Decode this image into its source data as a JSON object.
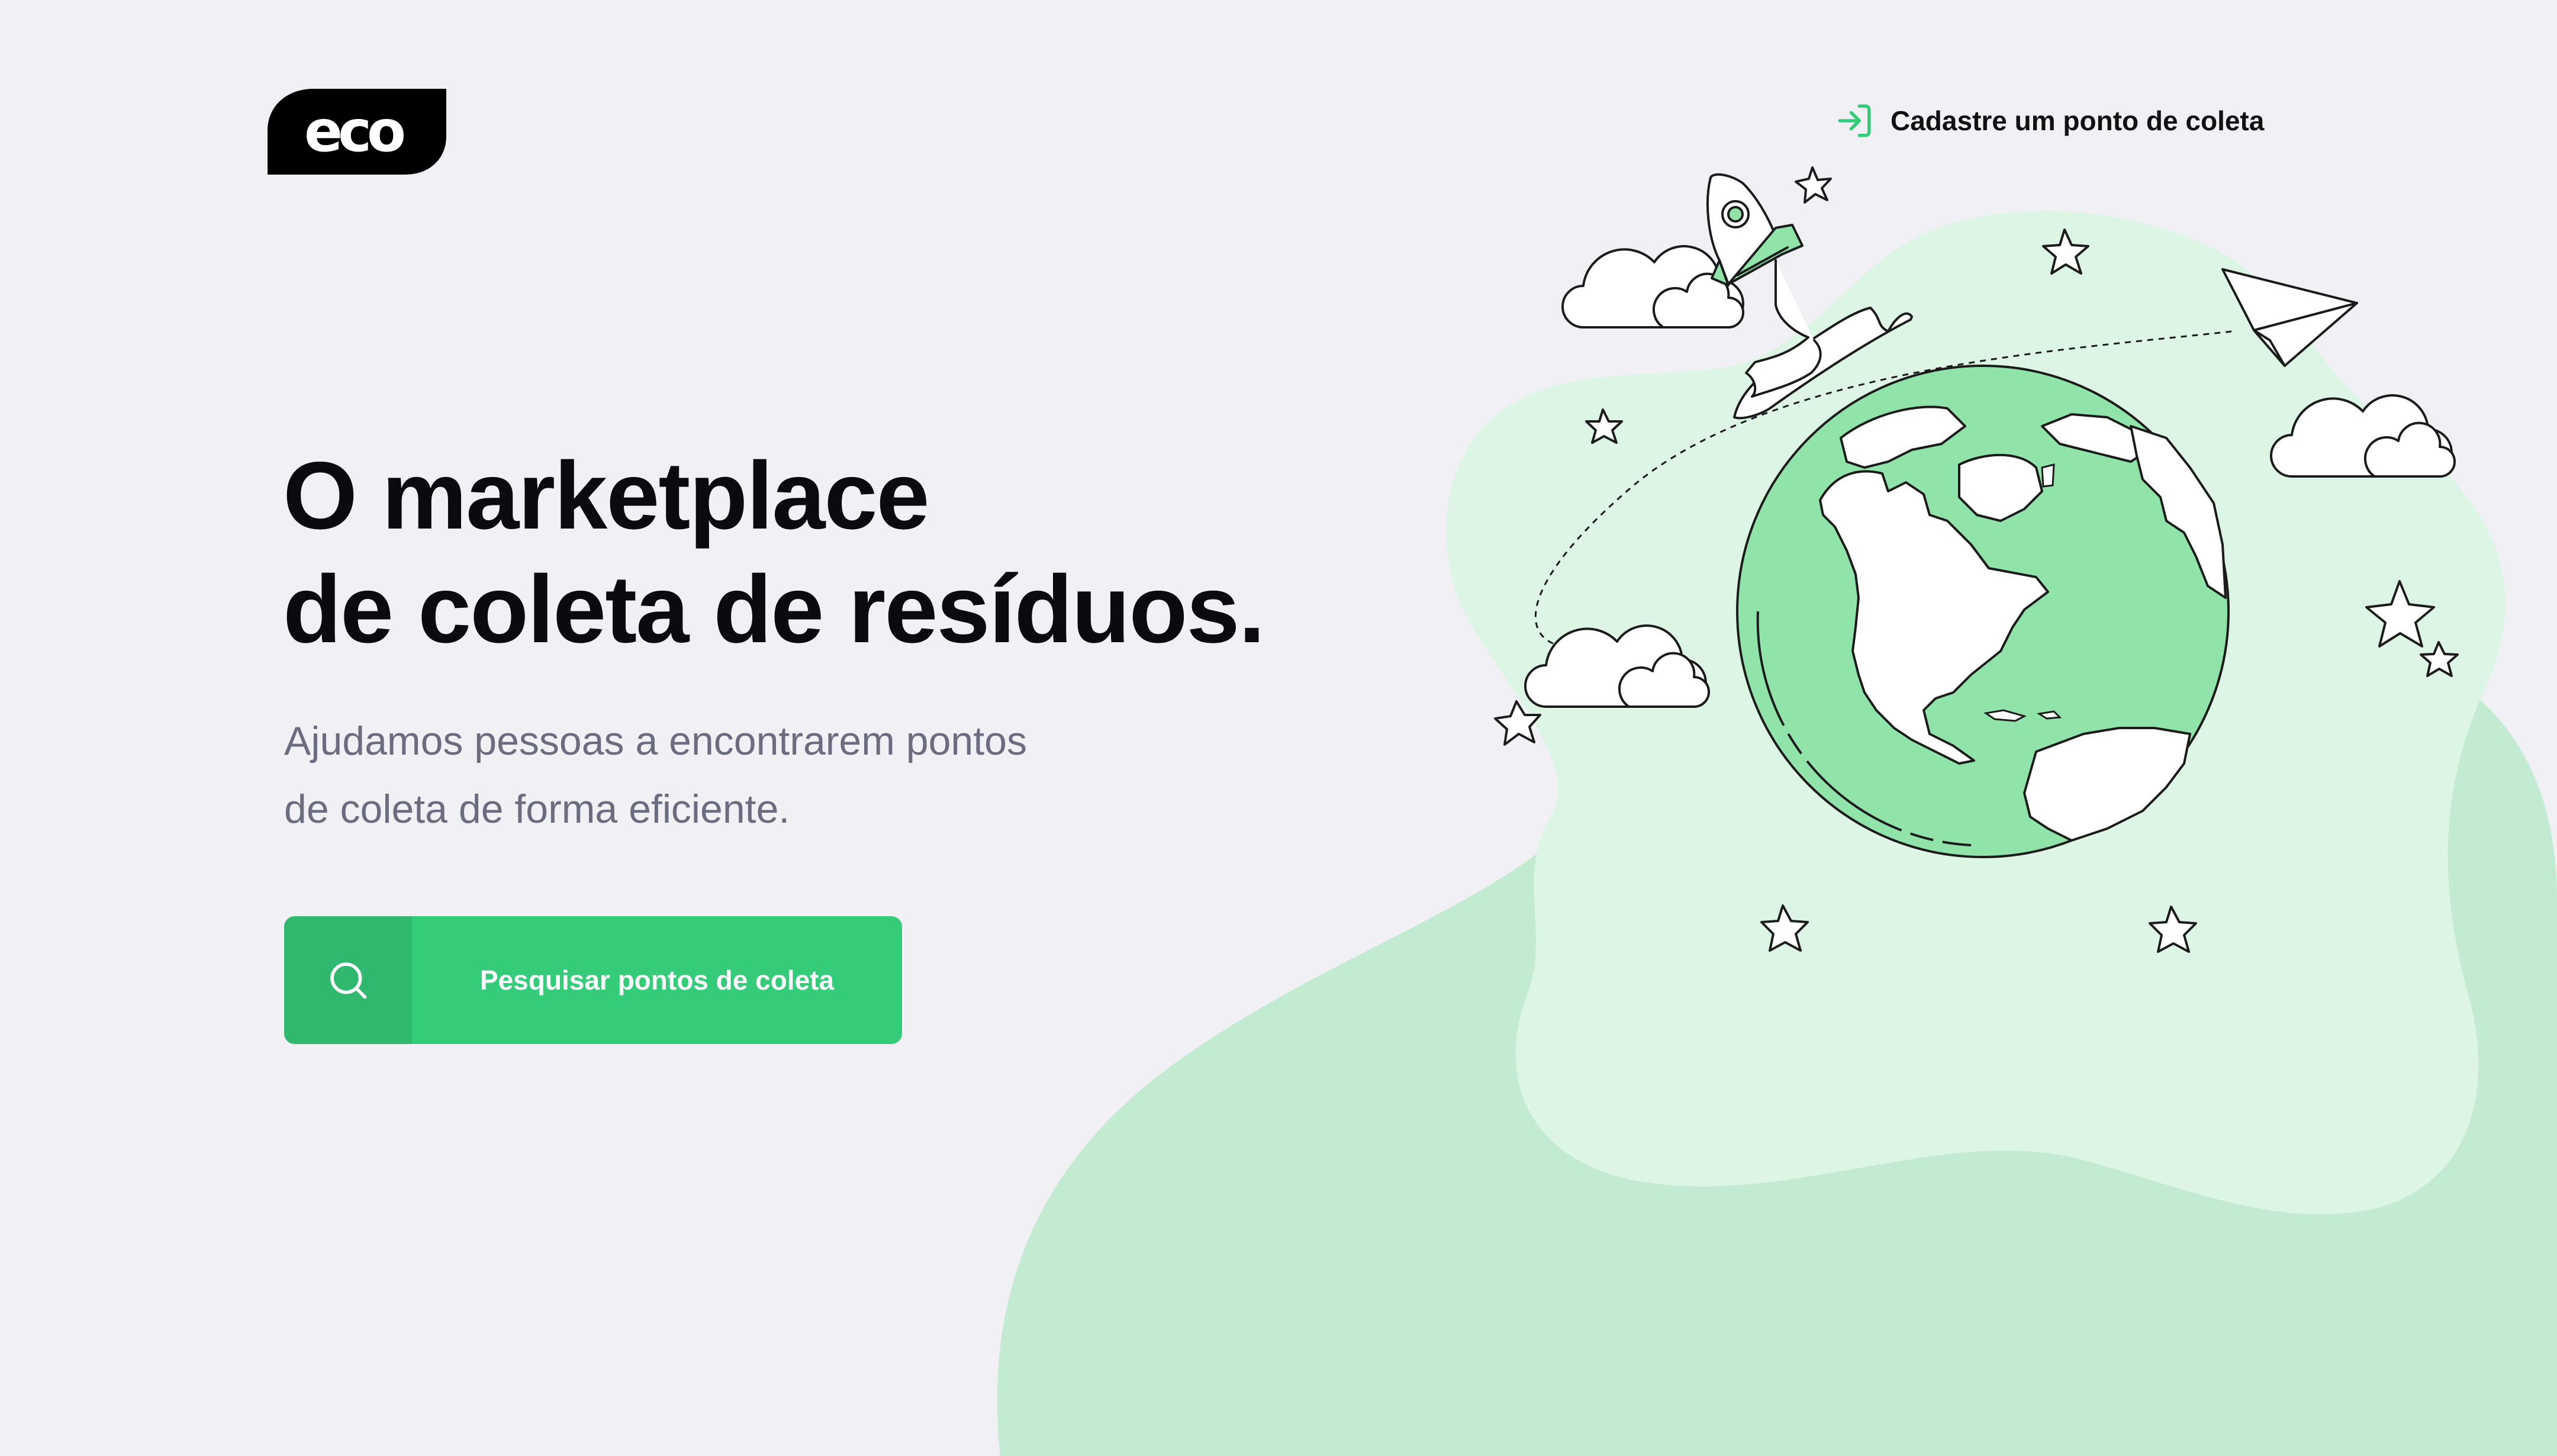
{
  "brand": {
    "logo_text": "eco",
    "logo_color": "#000000",
    "accent_color": "#34CB79",
    "accent_dark_color": "#2FB86E"
  },
  "header": {
    "link_label": "Cadastre um ponto de coleta",
    "link_icon": "log-in-icon"
  },
  "hero": {
    "title_line1": "O marketplace",
    "title_line2": "de coleta de resíduos.",
    "description_line1": "Ajudamos pessoas a encontrarem pontos",
    "description_line2": "de coleta de forma eficiente.",
    "cta_label": "Pesquisar pontos de coleta",
    "cta_icon": "search-icon"
  },
  "illustration": {
    "subject": "globe-icon",
    "elements": [
      "rocket-icon",
      "paper-plane-icon",
      "cloud-icon",
      "star-icon"
    ],
    "blob_light_color": "#DDF5E5",
    "blob_mid_color": "#C2EBD2",
    "globe_land_color": "#FFFFFF",
    "globe_ocean_color": "#90E4A9"
  }
}
